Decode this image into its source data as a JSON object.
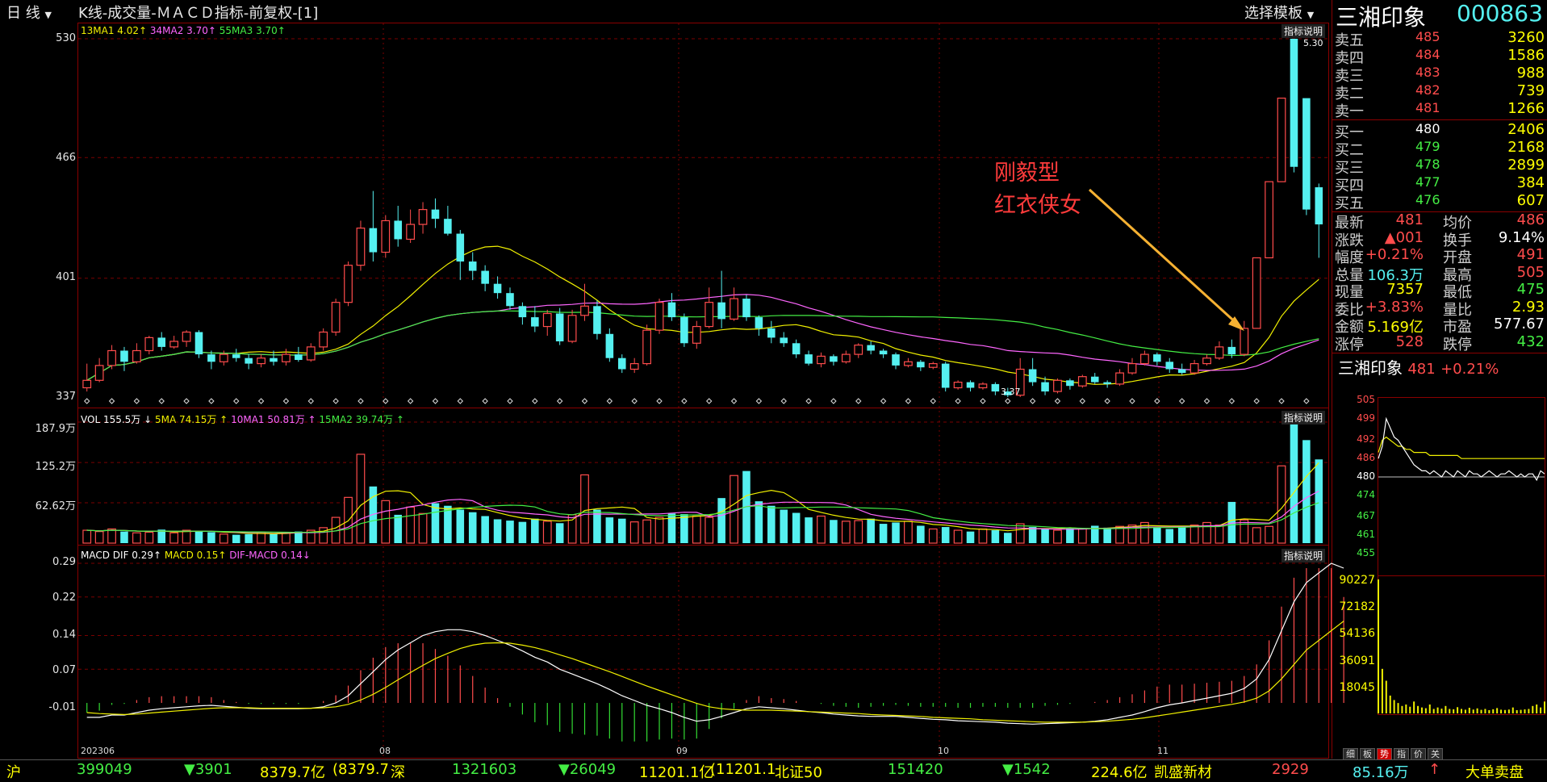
{
  "colors": {
    "up": "#ff4c4c",
    "down": "#55f0f0",
    "ma1": "#f0f000",
    "ma2": "#ff66ff",
    "ma3": "#44ee44",
    "grid": "#7a0000",
    "frame": "#8a0000"
  },
  "header": {
    "period": "日 线",
    "chart_title": "K线-成交量-ＭＡＣＤ指标-前复权-[1]",
    "template_btn": "选择模板",
    "stock_name": "三湘印象",
    "stock_code": "000863"
  },
  "kline": {
    "ma_label1": "13MA1 4.02↑",
    "ma_label2": "34MA2 3.70↑",
    "ma_label3": "55MA3 3.70↑",
    "help": "指标说明",
    "high_mark": "5.30",
    "low_mark": "3.37",
    "y_ticks": [
      "530",
      "466",
      "401",
      "337"
    ],
    "annotation": [
      "刚毅型",
      "红衣侠女"
    ]
  },
  "vol": {
    "label1": "VOL 155.5万 ↓",
    "label2": "5MA 74.15万 ↑",
    "label3": "10MA1 50.81万 ↑",
    "label4": "15MA2 39.74万 ↑",
    "help": "指标说明",
    "y_ticks": [
      "187.9万",
      "125.2万",
      "62.62万"
    ]
  },
  "macd": {
    "label1": "MACD DIF 0.29↑",
    "label2": "MACD 0.15↑",
    "label3": "DIF-MACD 0.14↓",
    "help": "指标说明",
    "y_ticks": [
      "0.29",
      "0.22",
      "0.14",
      "0.07",
      "-0.01"
    ]
  },
  "x_axis": [
    "202306",
    "08",
    "09",
    "10",
    "11"
  ],
  "orderbook": {
    "sell": [
      {
        "label": "卖五",
        "price": "485",
        "vol": "3260"
      },
      {
        "label": "卖四",
        "price": "484",
        "vol": "1586"
      },
      {
        "label": "卖三",
        "price": "483",
        "vol": "988"
      },
      {
        "label": "卖二",
        "price": "482",
        "vol": "739"
      },
      {
        "label": "卖一",
        "price": "481",
        "vol": "1266"
      }
    ],
    "buy": [
      {
        "label": "买一",
        "price": "480",
        "vol": "2406"
      },
      {
        "label": "买二",
        "price": "479",
        "vol": "2168"
      },
      {
        "label": "买三",
        "price": "478",
        "vol": "2899"
      },
      {
        "label": "买四",
        "price": "477",
        "vol": "384"
      },
      {
        "label": "买五",
        "price": "476",
        "vol": "607"
      }
    ]
  },
  "stats": [
    {
      "l1": "最新",
      "v1": "481",
      "c1": "#ff4c4c",
      "l2": "均价",
      "v2": "486",
      "c2": "#ff4c4c"
    },
    {
      "l1": "涨跌",
      "v1": "▲001",
      "c1": "#ff4c4c",
      "l2": "换手",
      "v2": "9.14%",
      "c2": "#ffffff"
    },
    {
      "l1": "幅度",
      "v1": "+0.21%",
      "c1": "#ff4c4c",
      "l2": "开盘",
      "v2": "491",
      "c2": "#ff4c4c"
    },
    {
      "l1": "总量",
      "v1": "106.3万",
      "c1": "#55f0f0",
      "l2": "最高",
      "v2": "505",
      "c2": "#ff4c4c"
    },
    {
      "l1": "现量",
      "v1": "7357",
      "c1": "#ffff00",
      "l2": "最低",
      "v2": "475",
      "c2": "#44ee44"
    },
    {
      "l1": "委比",
      "v1": "+3.83%",
      "c1": "#ff4c4c",
      "l2": "量比",
      "v2": "2.93",
      "c2": "#ffff00"
    },
    {
      "l1": "金额",
      "v1": "5.169亿",
      "c1": "#ffff00",
      "l2": "市盈",
      "v2": "577.67",
      "c2": "#ffffff"
    },
    {
      "l1": "涨停",
      "v1": "528",
      "c1": "#ff4c4c",
      "l2": "跌停",
      "v2": "432",
      "c2": "#44ee44"
    }
  ],
  "mini": {
    "name": "三湘印象",
    "price": "481",
    "change": "+0.21%",
    "price_ticks": [
      "505",
      "499",
      "492",
      "486",
      "480",
      "474",
      "467",
      "461",
      "455"
    ],
    "vol_ticks": [
      "90227",
      "72182",
      "54136",
      "36091",
      "18045"
    ],
    "tabs": [
      "细",
      "板",
      "势",
      "指",
      "价",
      "关"
    ]
  },
  "bottom": [
    {
      "t": "沪",
      "c": "#ffff00",
      "x": 8
    },
    {
      "t": "399049",
      "c": "#44ee44",
      "x": 95
    },
    {
      "t": "▼3901",
      "c": "#44ee44",
      "x": 228
    },
    {
      "t": "8379.7亿",
      "c": "#ffff00",
      "x": 322
    },
    {
      "t": "(8379.7",
      "c": "#ffff00",
      "x": 412
    },
    {
      "t": "深",
      "c": "#ffff00",
      "x": 484
    },
    {
      "t": "1321603",
      "c": "#44ee44",
      "x": 560
    },
    {
      "t": "▼26049",
      "c": "#44ee44",
      "x": 692
    },
    {
      "t": "11201.1亿",
      "c": "#ffff00",
      "x": 792
    },
    {
      "t": "(11201.1",
      "c": "#ffff00",
      "x": 880
    },
    {
      "t": "北证50",
      "c": "#ffff00",
      "x": 960
    },
    {
      "t": "151420",
      "c": "#44ee44",
      "x": 1100
    },
    {
      "t": "▼1542",
      "c": "#44ee44",
      "x": 1242
    },
    {
      "t": "224.6亿",
      "c": "#ffff00",
      "x": 1352
    },
    {
      "t": "凯盛新材",
      "c": "#ffff00",
      "x": 1430
    },
    {
      "t": "2929",
      "c": "#ff4c4c",
      "x": 1576
    },
    {
      "t": "85.16万",
      "c": "#55f0f0",
      "x": 1676
    },
    {
      "t": "↑",
      "c": "#ff4c4c",
      "x": 1770
    },
    {
      "t": "大单卖盘",
      "c": "#ffff00",
      "x": 1816
    }
  ],
  "chart_data": {
    "type": "candlestick",
    "x_labels": [
      "202306",
      "08",
      "09",
      "10",
      "11"
    ],
    "price_range": [
      3.37,
      5.3
    ],
    "candles": [
      [
        3.42,
        3.46,
        3.55,
        3.4
      ],
      [
        3.46,
        3.54,
        3.58,
        3.45
      ],
      [
        3.54,
        3.62,
        3.65,
        3.52
      ],
      [
        3.62,
        3.56,
        3.64,
        3.51
      ],
      [
        3.56,
        3.62,
        3.66,
        3.55
      ],
      [
        3.62,
        3.69,
        3.7,
        3.6
      ],
      [
        3.69,
        3.64,
        3.72,
        3.62
      ],
      [
        3.64,
        3.67,
        3.7,
        3.63
      ],
      [
        3.67,
        3.72,
        3.73,
        3.64
      ],
      [
        3.72,
        3.6,
        3.73,
        3.58
      ],
      [
        3.6,
        3.56,
        3.62,
        3.52
      ],
      [
        3.56,
        3.6,
        3.62,
        3.54
      ],
      [
        3.6,
        3.58,
        3.63,
        3.56
      ],
      [
        3.58,
        3.55,
        3.6,
        3.52
      ],
      [
        3.55,
        3.58,
        3.6,
        3.53
      ],
      [
        3.58,
        3.56,
        3.62,
        3.54
      ],
      [
        3.56,
        3.6,
        3.63,
        3.54
      ],
      [
        3.6,
        3.57,
        3.64,
        3.56
      ],
      [
        3.57,
        3.64,
        3.66,
        3.56
      ],
      [
        3.64,
        3.72,
        3.74,
        3.62
      ],
      [
        3.72,
        3.88,
        3.9,
        3.7
      ],
      [
        3.88,
        4.08,
        4.1,
        3.86
      ],
      [
        4.08,
        4.28,
        4.32,
        4.05
      ],
      [
        4.28,
        4.15,
        4.48,
        4.1
      ],
      [
        4.15,
        4.32,
        4.35,
        4.12
      ],
      [
        4.32,
        4.22,
        4.4,
        4.18
      ],
      [
        4.22,
        4.3,
        4.38,
        4.2
      ],
      [
        4.3,
        4.38,
        4.42,
        4.25
      ],
      [
        4.38,
        4.33,
        4.44,
        4.28
      ],
      [
        4.33,
        4.25,
        4.4,
        4.24
      ],
      [
        4.25,
        4.1,
        4.27,
        4.0
      ],
      [
        4.1,
        4.05,
        4.15,
        4.0
      ],
      [
        4.05,
        3.98,
        4.08,
        3.94
      ],
      [
        3.98,
        3.93,
        4.02,
        3.9
      ],
      [
        3.93,
        3.86,
        3.96,
        3.84
      ],
      [
        3.86,
        3.8,
        3.88,
        3.76
      ],
      [
        3.8,
        3.75,
        3.86,
        3.72
      ],
      [
        3.75,
        3.82,
        3.84,
        3.7
      ],
      [
        3.82,
        3.67,
        3.85,
        3.65
      ],
      [
        3.67,
        3.81,
        3.84,
        3.66
      ],
      [
        3.81,
        3.86,
        3.98,
        3.78
      ],
      [
        3.86,
        3.71,
        3.89,
        3.68
      ],
      [
        3.71,
        3.58,
        3.74,
        3.56
      ],
      [
        3.58,
        3.52,
        3.6,
        3.5
      ],
      [
        3.52,
        3.55,
        3.58,
        3.5
      ],
      [
        3.55,
        3.73,
        3.76,
        3.54
      ],
      [
        3.73,
        3.88,
        3.9,
        3.71
      ],
      [
        3.88,
        3.8,
        3.93,
        3.78
      ],
      [
        3.8,
        3.66,
        3.82,
        3.64
      ],
      [
        3.66,
        3.75,
        3.78,
        3.63
      ],
      [
        3.75,
        3.88,
        3.96,
        3.74
      ],
      [
        3.88,
        3.79,
        4.05,
        3.74
      ],
      [
        3.79,
        3.9,
        3.96,
        3.78
      ],
      [
        3.9,
        3.8,
        3.92,
        3.78
      ],
      [
        3.8,
        3.74,
        3.81,
        3.7
      ],
      [
        3.74,
        3.69,
        3.78,
        3.66
      ],
      [
        3.69,
        3.66,
        3.72,
        3.64
      ],
      [
        3.66,
        3.6,
        3.68,
        3.58
      ],
      [
        3.6,
        3.55,
        3.62,
        3.54
      ],
      [
        3.55,
        3.59,
        3.61,
        3.53
      ],
      [
        3.59,
        3.56,
        3.6,
        3.54
      ],
      [
        3.56,
        3.6,
        3.62,
        3.55
      ],
      [
        3.6,
        3.65,
        3.66,
        3.58
      ],
      [
        3.65,
        3.62,
        3.67,
        3.6
      ],
      [
        3.62,
        3.6,
        3.63,
        3.58
      ],
      [
        3.6,
        3.54,
        3.61,
        3.52
      ],
      [
        3.54,
        3.56,
        3.58,
        3.53
      ],
      [
        3.56,
        3.53,
        3.57,
        3.51
      ],
      [
        3.53,
        3.55,
        3.56,
        3.52
      ],
      [
        3.55,
        3.42,
        3.56,
        3.4
      ],
      [
        3.42,
        3.45,
        3.46,
        3.41
      ],
      [
        3.45,
        3.42,
        3.46,
        3.4
      ],
      [
        3.42,
        3.44,
        3.45,
        3.41
      ],
      [
        3.44,
        3.4,
        3.45,
        3.38
      ],
      [
        3.4,
        3.38,
        3.42,
        3.37
      ],
      [
        3.38,
        3.52,
        3.58,
        3.37
      ],
      [
        3.52,
        3.45,
        3.58,
        3.43
      ],
      [
        3.45,
        3.4,
        3.48,
        3.38
      ],
      [
        3.4,
        3.46,
        3.47,
        3.39
      ],
      [
        3.46,
        3.43,
        3.47,
        3.41
      ],
      [
        3.43,
        3.48,
        3.49,
        3.42
      ],
      [
        3.48,
        3.45,
        3.5,
        3.44
      ],
      [
        3.45,
        3.44,
        3.46,
        3.42
      ],
      [
        3.44,
        3.5,
        3.52,
        3.43
      ],
      [
        3.5,
        3.55,
        3.58,
        3.49
      ],
      [
        3.55,
        3.6,
        3.62,
        3.54
      ],
      [
        3.6,
        3.56,
        3.61,
        3.54
      ],
      [
        3.56,
        3.52,
        3.58,
        3.5
      ],
      [
        3.52,
        3.5,
        3.55,
        3.49
      ],
      [
        3.5,
        3.55,
        3.57,
        3.49
      ],
      [
        3.55,
        3.58,
        3.6,
        3.54
      ],
      [
        3.58,
        3.64,
        3.67,
        3.57
      ],
      [
        3.64,
        3.6,
        3.68,
        3.58
      ],
      [
        3.6,
        3.74,
        3.78,
        3.59
      ],
      [
        3.74,
        4.12,
        4.12,
        4.12
      ],
      [
        4.12,
        4.53,
        4.53,
        4.53
      ],
      [
        4.53,
        4.98,
        4.98,
        4.98
      ],
      [
        5.3,
        4.61,
        5.3,
        4.58
      ],
      [
        4.98,
        4.38,
        4.9,
        4.35
      ],
      [
        4.5,
        4.3,
        4.52,
        4.12
      ]
    ],
    "volume": [
      20,
      18,
      22,
      18,
      16,
      17,
      21,
      16,
      20,
      18,
      17,
      14,
      13,
      14,
      17,
      15,
      16,
      18,
      20,
      24,
      40,
      71,
      138,
      88,
      66,
      44,
      56,
      46,
      62,
      58,
      52,
      48,
      42,
      37,
      35,
      33,
      38,
      34,
      31,
      44,
      106,
      52,
      40,
      38,
      33,
      36,
      40,
      46,
      45,
      42,
      40,
      70,
      105,
      112,
      65,
      58,
      52,
      47,
      40,
      42,
      36,
      34,
      35,
      38,
      30,
      32,
      34,
      27,
      22,
      25,
      20,
      18,
      22,
      20,
      16,
      30,
      25,
      22,
      20,
      23,
      22,
      27,
      24,
      26,
      28,
      32,
      25,
      22,
      26,
      28,
      32,
      28,
      64,
      36,
      24,
      26,
      120,
      188,
      160,
      130
    ],
    "dif": [
      -0.03,
      -0.03,
      -0.025,
      -0.025,
      -0.02,
      -0.015,
      -0.012,
      -0.01,
      -0.008,
      -0.006,
      -0.005,
      -0.007,
      -0.009,
      -0.011,
      -0.012,
      -0.012,
      -0.012,
      -0.012,
      -0.011,
      -0.008,
      0.0,
      0.015,
      0.04,
      0.065,
      0.09,
      0.11,
      0.125,
      0.14,
      0.148,
      0.152,
      0.152,
      0.148,
      0.14,
      0.13,
      0.12,
      0.108,
      0.095,
      0.085,
      0.07,
      0.06,
      0.05,
      0.04,
      0.028,
      0.015,
      0.005,
      -0.005,
      -0.012,
      -0.02,
      -0.03,
      -0.038,
      -0.035,
      -0.028,
      -0.02,
      -0.012,
      -0.008,
      -0.01,
      -0.012,
      -0.015,
      -0.018,
      -0.02,
      -0.023,
      -0.025,
      -0.027,
      -0.028,
      -0.028,
      -0.028,
      -0.03,
      -0.032,
      -0.034,
      -0.035,
      -0.037,
      -0.038,
      -0.039,
      -0.04,
      -0.042,
      -0.043,
      -0.044,
      -0.043,
      -0.042,
      -0.041,
      -0.04,
      -0.038,
      -0.035,
      -0.03,
      -0.025,
      -0.018,
      -0.01,
      -0.004,
      0.0,
      0.005,
      0.01,
      0.015,
      0.02,
      0.03,
      0.05,
      0.09,
      0.15,
      0.21,
      0.25,
      0.27,
      0.29,
      0.28
    ],
    "dea": [
      -0.02,
      -0.022,
      -0.023,
      -0.024,
      -0.023,
      -0.021,
      -0.019,
      -0.017,
      -0.015,
      -0.013,
      -0.011,
      -0.01,
      -0.01,
      -0.01,
      -0.011,
      -0.011,
      -0.011,
      -0.011,
      -0.011,
      -0.01,
      -0.008,
      -0.003,
      0.006,
      0.018,
      0.032,
      0.048,
      0.063,
      0.078,
      0.092,
      0.103,
      0.113,
      0.12,
      0.124,
      0.125,
      0.124,
      0.12,
      0.115,
      0.108,
      0.1,
      0.092,
      0.083,
      0.074,
      0.065,
      0.055,
      0.045,
      0.035,
      0.026,
      0.017,
      0.008,
      -0.001,
      -0.008,
      -0.012,
      -0.014,
      -0.015,
      -0.015,
      -0.015,
      -0.016,
      -0.017,
      -0.018,
      -0.019,
      -0.02,
      -0.021,
      -0.022,
      -0.024,
      -0.025,
      -0.026,
      -0.027,
      -0.028,
      -0.03,
      -0.031,
      -0.032,
      -0.033,
      -0.035,
      -0.036,
      -0.037,
      -0.038,
      -0.039,
      -0.04,
      -0.04,
      -0.04,
      -0.04,
      -0.039,
      -0.038,
      -0.036,
      -0.034,
      -0.031,
      -0.027,
      -0.023,
      -0.019,
      -0.015,
      -0.011,
      -0.007,
      -0.003,
      0.002,
      0.01,
      0.025,
      0.05,
      0.08,
      0.11,
      0.13,
      0.15,
      0.17
    ],
    "mini_price": [
      4.86,
      4.9,
      4.99,
      4.96,
      4.93,
      4.92,
      4.9,
      4.88,
      4.86,
      4.84,
      4.83,
      4.82,
      4.82,
      4.81,
      4.82,
      4.81,
      4.8,
      4.82,
      4.81,
      4.8,
      4.82,
      4.81,
      4.8,
      4.82,
      4.81,
      4.81,
      4.8,
      4.81,
      4.82,
      4.81,
      4.8,
      4.81,
      4.81,
      4.82,
      4.81,
      4.8,
      4.81,
      4.8,
      4.81,
      4.81,
      4.79,
      4.82,
      4.81
    ],
    "mini_avg": [
      4.88,
      4.92,
      4.93,
      4.92,
      4.91,
      4.9,
      4.9,
      4.89,
      4.89,
      4.88,
      4.88,
      4.88,
      4.88,
      4.87,
      4.87,
      4.87,
      4.87,
      4.87,
      4.87,
      4.87,
      4.87,
      4.86,
      4.86,
      4.86,
      4.86,
      4.86,
      4.86,
      4.86,
      4.86,
      4.86,
      4.86,
      4.86,
      4.86,
      4.86,
      4.86,
      4.86,
      4.86,
      4.86,
      4.86,
      4.86,
      4.86,
      4.86,
      4.86
    ],
    "mini_vol": [
      90227,
      30000,
      22000,
      12000,
      9000,
      7000,
      5000,
      6000,
      4500,
      8000,
      5000,
      4000,
      3500,
      6000,
      3000,
      4000,
      3200,
      5000,
      3000,
      2800,
      4200,
      3000,
      2500,
      3800,
      2600,
      3400,
      2400,
      3000,
      2200,
      2800,
      3600,
      2500,
      2300,
      2600,
      4000,
      2200,
      2400,
      2700,
      3000,
      5000,
      6000,
      4000,
      8000
    ]
  }
}
